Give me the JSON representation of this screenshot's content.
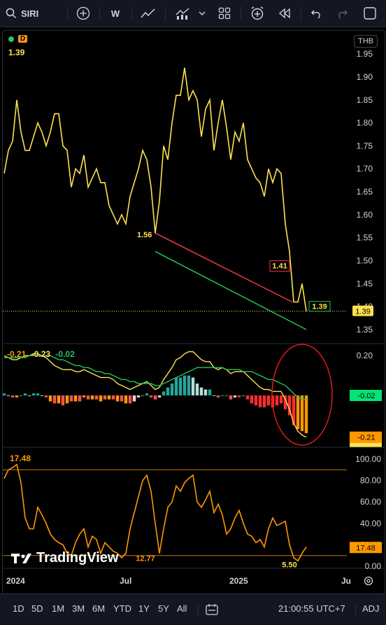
{
  "toolbar": {
    "symbol": "SIRI",
    "interval": "W",
    "colors": {
      "bg": "#131722",
      "text": "#d1d4dc"
    }
  },
  "legend": {
    "source_badge": "D",
    "last_price": "1.39",
    "currency_button": "THB",
    "macd_values": [
      "-0.21",
      "-0.23",
      "-0.02"
    ],
    "rsi_value": "17.48"
  },
  "price_axis": {
    "ticks": [
      "1.95",
      "1.90",
      "1.85",
      "1.80",
      "1.75",
      "1.70",
      "1.65",
      "1.60",
      "1.55",
      "1.50",
      "1.45",
      "1.40",
      "1.35"
    ],
    "current_label": "1.39"
  },
  "macd_axis": {
    "ticks": [
      "0.20"
    ],
    "badges": [
      "-0.02",
      "-0.21",
      "-0.23"
    ]
  },
  "rsi_axis": {
    "ticks": [
      "100.00",
      "80.00",
      "60.00",
      "40.00",
      "20.00",
      "0.00"
    ],
    "current_label": "17.48"
  },
  "time_axis": {
    "labels": [
      "2024",
      "Jul",
      "2025",
      "Ju"
    ]
  },
  "annotations": {
    "price_low_label": "1.56",
    "trend_end_label": "1.41",
    "last_label": "1.39",
    "rsi_low_1": "12.77",
    "rsi_low_2": "5.50"
  },
  "watermark": "TradingView",
  "bottombar": {
    "periods": [
      "1D",
      "5D",
      "1M",
      "3M",
      "6M",
      "YTD",
      "1Y",
      "5Y",
      "All"
    ],
    "clock": "21:00:55 UTC+7",
    "adj": "ADJ"
  },
  "chart_data": {
    "type": "line",
    "symbol": "SIRI",
    "interval": "weekly",
    "price_series": [
      1.69,
      1.74,
      1.76,
      1.85,
      1.78,
      1.74,
      1.74,
      1.77,
      1.8,
      1.78,
      1.75,
      1.78,
      1.82,
      1.82,
      1.75,
      1.74,
      1.66,
      1.7,
      1.69,
      1.73,
      1.66,
      1.68,
      1.7,
      1.67,
      1.67,
      1.62,
      1.6,
      1.58,
      1.6,
      1.58,
      1.64,
      1.67,
      1.7,
      1.74,
      1.72,
      1.66,
      1.56,
      1.63,
      1.75,
      1.72,
      1.8,
      1.86,
      1.86,
      1.92,
      1.85,
      1.87,
      1.85,
      1.77,
      1.83,
      1.85,
      1.74,
      1.8,
      1.85,
      1.79,
      1.72,
      1.78,
      1.76,
      1.8,
      1.72,
      1.7,
      1.68,
      1.67,
      1.64,
      1.7,
      1.67,
      1.7,
      1.69,
      1.58,
      1.52,
      1.41,
      1.41,
      1.45,
      1.39
    ],
    "trendlines": [
      {
        "color": "#f23645",
        "from": 1.56,
        "to": 1.41
      },
      {
        "color": "#22c55e",
        "from": 1.52,
        "to": 1.35
      }
    ],
    "price_ylim": [
      1.33,
      1.97
    ],
    "macd_line": [
      0.2,
      0.19,
      0.18,
      0.18,
      0.19,
      0.2,
      0.2,
      0.21,
      0.21,
      0.2,
      0.19,
      0.17,
      0.15,
      0.14,
      0.13,
      0.13,
      0.13,
      0.12,
      0.12,
      0.13,
      0.12,
      0.11,
      0.1,
      0.09,
      0.09,
      0.09,
      0.08,
      0.06,
      0.05,
      0.04,
      0.03,
      0.04,
      0.05,
      0.06,
      0.07,
      0.05,
      0.03,
      0.04,
      0.08,
      0.11,
      0.14,
      0.18,
      0.19,
      0.21,
      0.22,
      0.22,
      0.2,
      0.18,
      0.17,
      0.17,
      0.14,
      0.13,
      0.14,
      0.13,
      0.11,
      0.12,
      0.12,
      0.12,
      0.1,
      0.08,
      0.06,
      0.04,
      0.03,
      0.03,
      0.02,
      0.02,
      0.02,
      -0.02,
      -0.07,
      -0.14,
      -0.18,
      -0.2,
      -0.21
    ],
    "signal_line": [
      0.19,
      0.19,
      0.19,
      0.19,
      0.19,
      0.19,
      0.2,
      0.2,
      0.2,
      0.2,
      0.2,
      0.2,
      0.19,
      0.18,
      0.18,
      0.17,
      0.16,
      0.15,
      0.15,
      0.14,
      0.14,
      0.13,
      0.12,
      0.12,
      0.11,
      0.11,
      0.1,
      0.09,
      0.08,
      0.08,
      0.07,
      0.07,
      0.06,
      0.06,
      0.06,
      0.06,
      0.05,
      0.05,
      0.06,
      0.07,
      0.08,
      0.09,
      0.1,
      0.11,
      0.12,
      0.13,
      0.14,
      0.14,
      0.14,
      0.14,
      0.14,
      0.14,
      0.14,
      0.13,
      0.13,
      0.13,
      0.13,
      0.12,
      0.12,
      0.12,
      0.11,
      0.1,
      0.09,
      0.08,
      0.08,
      0.07,
      0.06,
      0.05,
      0.03,
      0.01,
      -0.01,
      -0.02,
      -0.02
    ],
    "macd_ylim": [
      -0.25,
      0.25
    ],
    "rsi_series": [
      82,
      90,
      92,
      95,
      78,
      45,
      35,
      35,
      55,
      48,
      40,
      30,
      25,
      22,
      20,
      12,
      10,
      22,
      30,
      35,
      18,
      28,
      25,
      12,
      22,
      18,
      14,
      12,
      8,
      12,
      35,
      50,
      65,
      80,
      85,
      70,
      40,
      12,
      35,
      55,
      60,
      75,
      70,
      78,
      82,
      85,
      60,
      55,
      62,
      70,
      50,
      58,
      48,
      30,
      35,
      45,
      52,
      40,
      30,
      28,
      22,
      25,
      18,
      35,
      45,
      38,
      40,
      42,
      20,
      8,
      5,
      12,
      18
    ],
    "rsi_bands": [
      90,
      10
    ],
    "rsi_ylim": [
      0,
      100
    ],
    "x_labels": [
      "2024",
      "Jul",
      "2025",
      "Ju"
    ]
  }
}
